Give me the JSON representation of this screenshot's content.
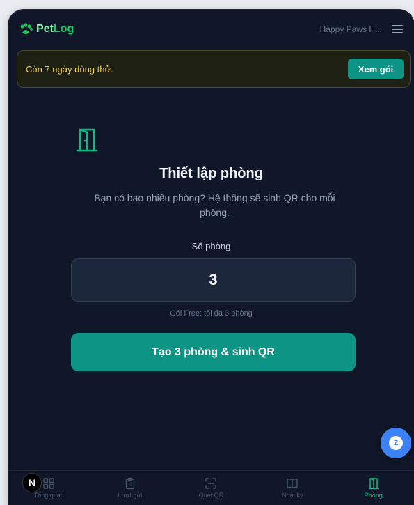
{
  "header": {
    "logo_text_1": "Pet",
    "logo_text_2": "Log",
    "clinic_name": "Happy Paws H..."
  },
  "trial_banner": {
    "text": "Còn 7 ngày dùng thử.",
    "button_label": "Xem gói"
  },
  "setup": {
    "title": "Thiết lập phòng",
    "subtitle": "Bạn có bao nhiêu phòng? Hệ thống sẽ sinh QR cho mỗi phòng.",
    "field_label": "Số phòng",
    "room_count": "3",
    "hint": "Gói Free: tối đa 3 phòng",
    "create_button": "Tạo 3 phòng & sinh QR"
  },
  "nav": [
    {
      "label": "Tổng quan",
      "icon": "grid-icon"
    },
    {
      "label": "Lượt gửi",
      "icon": "clipboard-icon"
    },
    {
      "label": "Quét QR",
      "icon": "scan-icon"
    },
    {
      "label": "Nhật ký",
      "icon": "book-icon"
    },
    {
      "label": "Phòng",
      "icon": "door-icon",
      "active": true
    }
  ],
  "chat_fab_letter": "Z",
  "badge_letter": "N",
  "colors": {
    "accent": "#0e9484",
    "active_nav": "#10b981",
    "background": "#0f1729",
    "trial_text": "#fbd34d"
  }
}
